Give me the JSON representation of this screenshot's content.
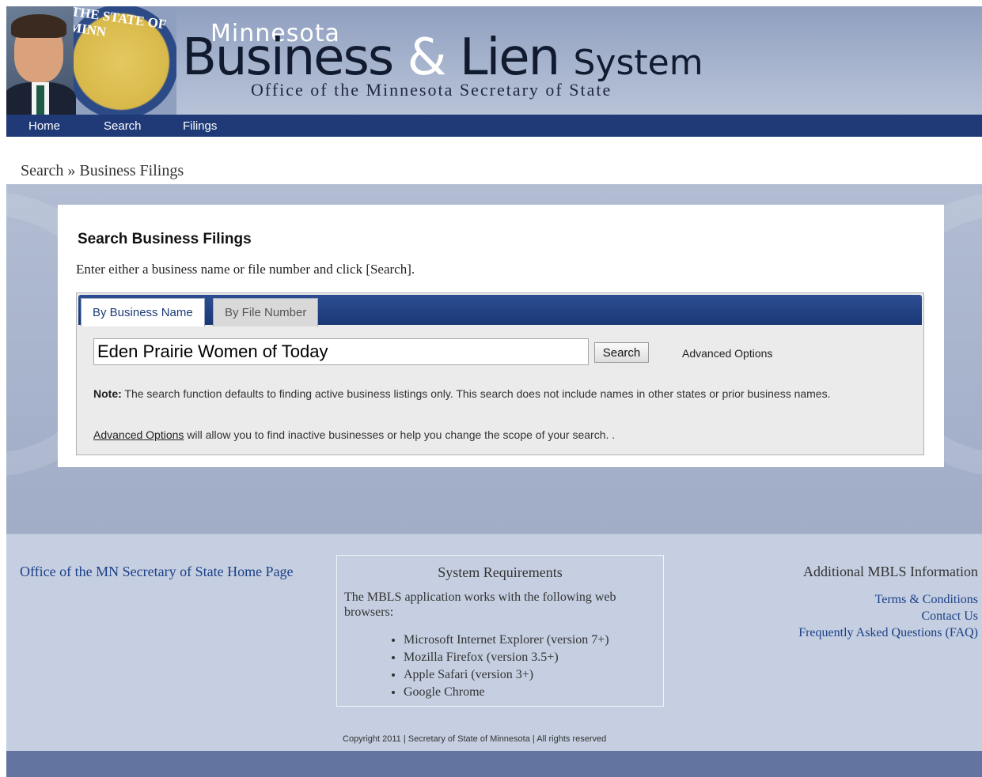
{
  "header": {
    "seal_text": "THE STATE OF MINN",
    "brand_line1": "Minnesota",
    "brand_word1": "Business",
    "brand_amp": "&",
    "brand_word2": "Lien",
    "brand_word3": "System",
    "brand_sub": "Office of the Minnesota Secretary of State"
  },
  "nav": {
    "items": [
      {
        "label": "Home"
      },
      {
        "label": "Search"
      },
      {
        "label": "Filings"
      }
    ]
  },
  "breadcrumb": "Search » Business Filings",
  "card": {
    "title": "Search Business Filings",
    "instructions": "Enter either a business name or file number and click [Search].",
    "tabs": [
      {
        "label": "By Business Name",
        "active": true
      },
      {
        "label": "By File Number",
        "active": false
      }
    ],
    "search_value": "Eden Prairie Women of Today",
    "search_button": "Search",
    "advanced_options": "Advanced Options",
    "note_label": "Note:",
    "note_text": " The search function defaults to finding active business listings only. This search does not include names in other states or prior business names.",
    "adv_link": "Advanced Options",
    "adv_text": " will allow you to find inactive businesses or help you change the scope of your search. ."
  },
  "footer": {
    "home_link": "Office of the MN Secretary of State Home Page",
    "sysreq": {
      "title": "System Requirements",
      "text": "The MBLS application works with the following web browsers:",
      "browsers": [
        "Microsoft Internet Explorer (version 7+)",
        "Mozilla Firefox (version 3.5+)",
        "Apple Safari (version 3+)",
        "Google Chrome"
      ]
    },
    "additional": {
      "title": "Additional MBLS Information",
      "links": [
        "Terms & Conditions",
        "Contact Us",
        "Frequently Asked Questions (FAQ)"
      ]
    },
    "copyright": "Copyright 2011 | Secretary of State of Minnesota | All rights reserved"
  },
  "colors": {
    "nav_bg": "#1f3a77",
    "link": "#1b3f86",
    "tab_bar": "#1a3775"
  }
}
